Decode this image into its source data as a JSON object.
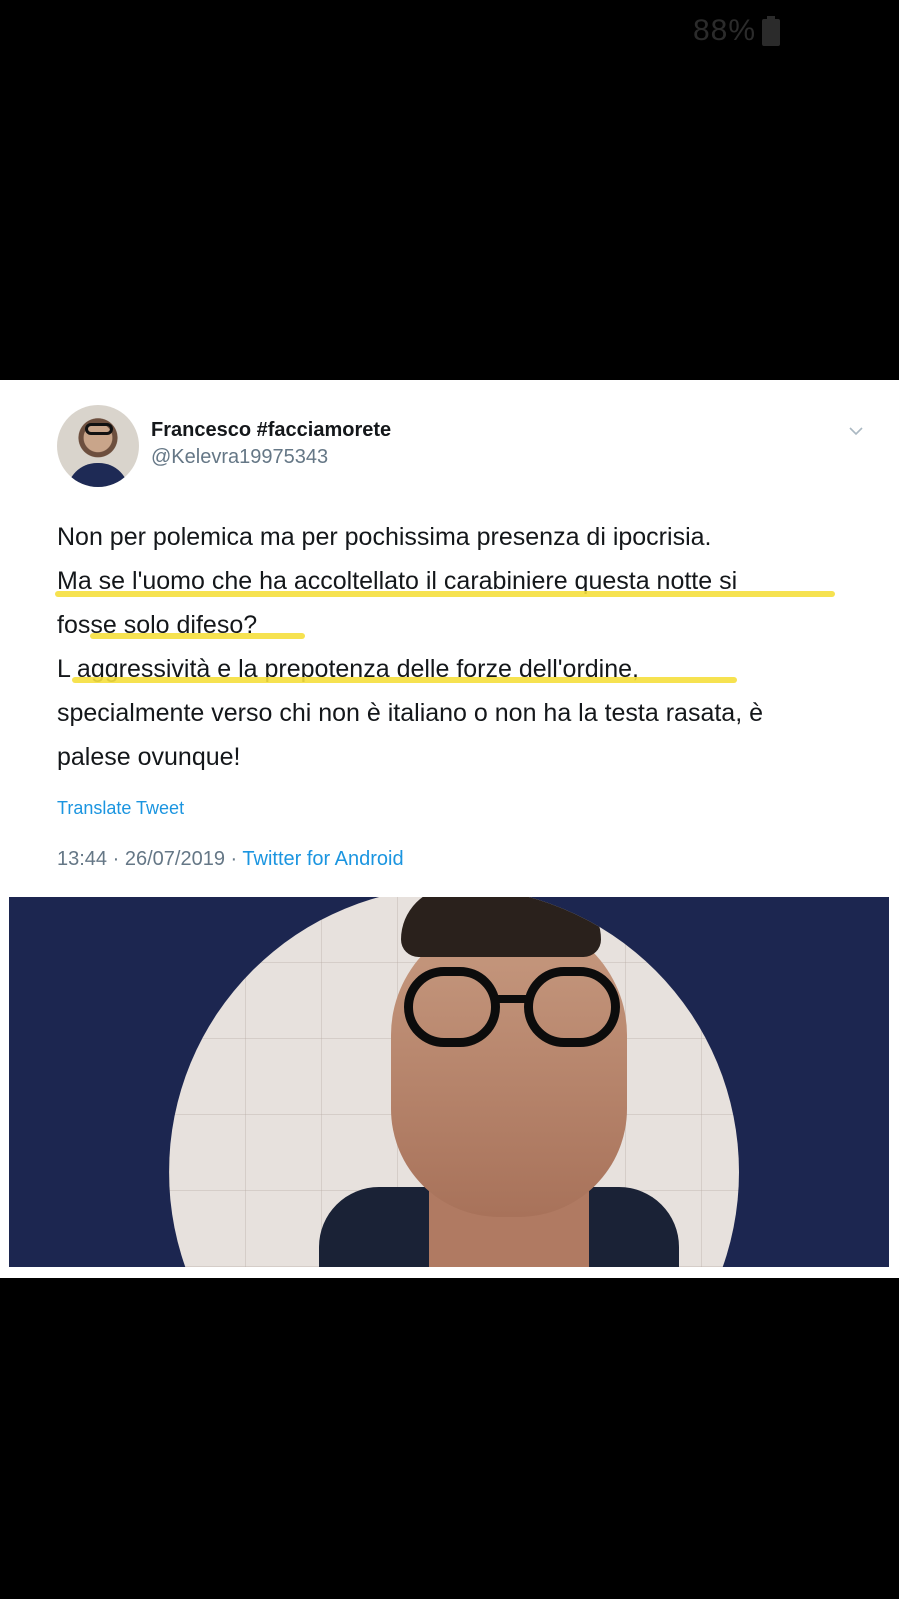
{
  "status_bar": {
    "battery_text": "88%",
    "battery_icon": "battery-icon"
  },
  "tweet": {
    "display_name": "Francesco #facciamorete",
    "handle": "@Kelevra19975343",
    "text_lines": [
      "Non per polemica ma per pochissima presenza di ipocrisia.",
      "Ma se l'uomo che ha accoltellato il carabiniere questa notte si",
      "fosse solo difeso?",
      "L aggressività e la prepotenza delle forze dell'ordine,",
      "specialmente verso chi non è italiano o non ha la testa rasata, è",
      "palese ovunque!"
    ],
    "translate_label": "Translate Tweet",
    "time": "13:44",
    "date": "26/07/2019",
    "separator": "·",
    "source": "Twitter for Android",
    "highlight_color": "#f5df3d",
    "link_color": "#1b95e0",
    "media_background": "#1c2650"
  }
}
